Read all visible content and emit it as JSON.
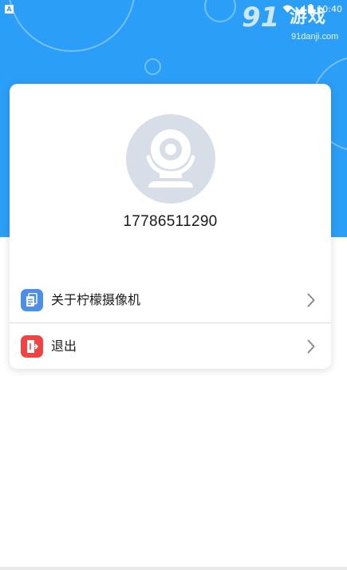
{
  "status_bar": {
    "notification_icon": "A",
    "time": "10:40"
  },
  "watermark": {
    "logo": "91",
    "brand": "游戏",
    "domain": "91danji.com"
  },
  "profile": {
    "avatar_icon": "camera-avatar-icon",
    "phone": "17786511290"
  },
  "menu": {
    "items": [
      {
        "label": "关于柠檬摄像机",
        "icon": "document-icon",
        "icon_color": "#4d8fe8"
      },
      {
        "label": "退出",
        "icon": "exit-door-icon",
        "icon_color": "#ee4444"
      }
    ]
  },
  "colors": {
    "header": "#2b9ef7",
    "card": "#ffffff",
    "avatar_bg": "#d8dee7"
  }
}
